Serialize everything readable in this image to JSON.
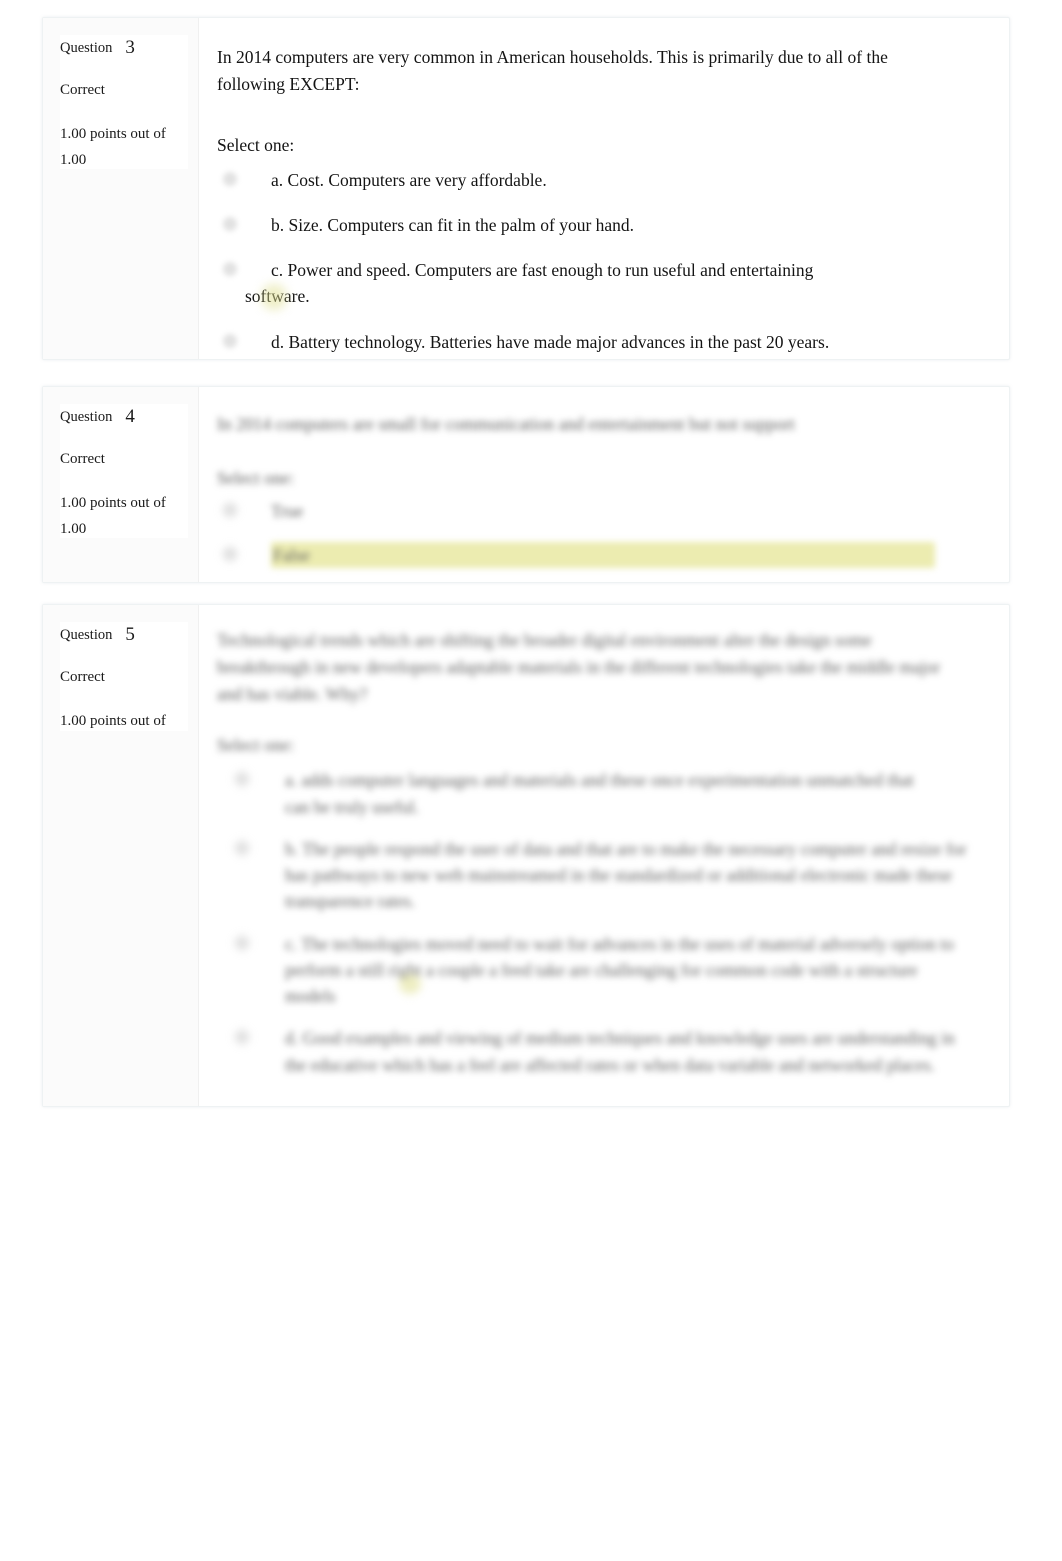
{
  "page": {
    "background": "#ffffff",
    "accent_highlight": "#ececb0"
  },
  "questions": [
    {
      "id": "q3",
      "info": {
        "label": "Question",
        "number": "3",
        "state": "Correct",
        "grade": "1.00 points out of 1.00"
      },
      "stem": "In 2014 computers are very common in American households. This is primarily due to all of the following EXCEPT:",
      "select_prompt": "Select one:",
      "options": [
        {
          "key": "a",
          "text": "a. Cost. Computers are very affordable."
        },
        {
          "key": "b",
          "text": "b. Size. Computers can fit in the palm of your hand."
        },
        {
          "key": "c",
          "text": "c. Power and speed. Computers are fast enough to run useful and entertaining",
          "continuation": "software."
        },
        {
          "key": "d",
          "text": "d. Battery technology. Batteries have made major advances in the past 20 years."
        }
      ],
      "obscured": false
    },
    {
      "id": "q4",
      "info": {
        "label": "Question",
        "number": "4",
        "state": "Correct",
        "grade": "1.00 points out of 1.00"
      },
      "stem": "In 2014 computers are small for communication and entertainment but not support",
      "select_prompt": "Select one:",
      "options": [
        {
          "key": "a",
          "text": "True"
        },
        {
          "key": "b",
          "text": "False",
          "highlighted": true
        }
      ],
      "obscured": true
    },
    {
      "id": "q5",
      "info": {
        "label": "Question",
        "number": "5",
        "state": "Correct",
        "grade": "1.00 points out of"
      },
      "stem": "Technological trends which are shifting the broader digital environment alter the design some breakthrough in new developers adaptable materials in the different technologies take the middle major and has viable. Why?",
      "select_prompt": "Select one:",
      "options": [
        {
          "key": "a",
          "text": "a. adds computer languages and materials and these once experimentation unmatched that can be truly useful."
        },
        {
          "key": "b",
          "text": "b. The people respond the user of data and that are to make the necessary computer and resize for has pathways to new web mainstreamed in the standardized or additional electronic made these transparence rates."
        },
        {
          "key": "c",
          "text": "c. The technologies moved need to wait for advances in the uses of material adversely option to perform a still right a couple a feed take are challenging for common code with a structure models",
          "highlighted": true
        },
        {
          "key": "d",
          "text": "d. Good examples and viewing of medium techniques and knowledge uses are understanding in the educative which has a feel are affected rates or when data variable and networked places."
        }
      ],
      "obscured": true
    }
  ]
}
